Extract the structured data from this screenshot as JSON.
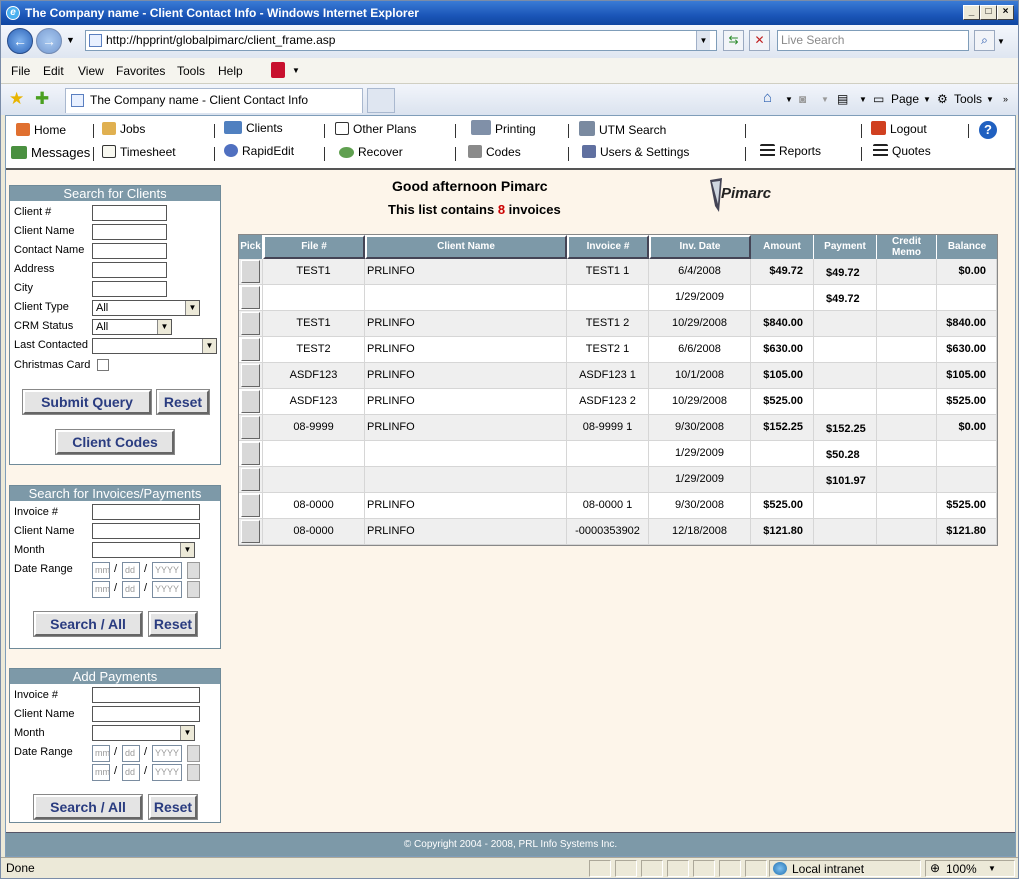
{
  "window": {
    "title": "The Company name - Client Contact Info - Windows Internet Explorer",
    "app_icon": "ie-icon"
  },
  "browser": {
    "url": "http://hpprint/globalpimarc/client_frame.asp",
    "live_search_placeholder": "Live Search",
    "menu": [
      "File",
      "Edit",
      "View",
      "Favorites",
      "Tools",
      "Help"
    ],
    "tab_title": "The Company name - Client Contact Info",
    "toolbar": {
      "page": "Page",
      "tools": "Tools"
    }
  },
  "nav": {
    "row1": [
      "Home",
      "Jobs",
      "Clients",
      "Other Plans",
      "Printing",
      "UTM Search",
      "Logout"
    ],
    "row2": [
      "Messages",
      "Timesheet",
      "RapidEdit",
      "Recover",
      "Codes",
      "Users & Settings",
      "Reports",
      "Quotes"
    ]
  },
  "search_clients": {
    "title": "Search for Clients",
    "labels": [
      "Client #",
      "Client Name",
      "Contact Name",
      "Address",
      "City",
      "Client Type",
      "CRM Status",
      "Last Contacted",
      "Christmas Card"
    ],
    "client_type": "All",
    "crm_status": "All",
    "submit": "Submit Query",
    "reset": "Reset",
    "codes": "Client Codes"
  },
  "search_invoices": {
    "title": "Search for Invoices/Payments",
    "labels": [
      "Invoice #",
      "Client Name",
      "Month",
      "Date Range"
    ],
    "search": "Search / All",
    "reset": "Reset"
  },
  "add_payments": {
    "title": "Add Payments",
    "labels": [
      "Invoice #",
      "Client Name",
      "Month",
      "Date Range"
    ],
    "search": "Search / All",
    "reset": "Reset"
  },
  "date_placeholders": {
    "mm": "mm",
    "dd": "dd",
    "yyyy": "YYYY"
  },
  "greeting": "Good afternoon Pimarc",
  "count": {
    "prefix": "This list contains",
    "n": "8",
    "suffix": "invoices"
  },
  "logo_text": "Pimarc",
  "table": {
    "headers": [
      "Pick",
      "File #",
      "Client Name",
      "Invoice #",
      "Inv. Date",
      "Amount",
      "Payment",
      "Credit Memo",
      "Balance"
    ],
    "rows": [
      [
        "TEST1",
        "PRLINFO",
        "TEST1 1",
        "6/4/2008",
        "$49.72",
        "$49.72",
        "",
        "$0.00"
      ],
      [
        "",
        "",
        "",
        "1/29/2009",
        "",
        "$49.72",
        "",
        ""
      ],
      [
        "TEST1",
        "PRLINFO",
        "TEST1 2",
        "10/29/2008",
        "$840.00",
        "",
        "",
        "$840.00"
      ],
      [
        "TEST2",
        "PRLINFO",
        "TEST2 1",
        "6/6/2008",
        "$630.00",
        "",
        "",
        "$630.00"
      ],
      [
        "ASDF123",
        "PRLINFO",
        "ASDF123 1",
        "10/1/2008",
        "$105.00",
        "",
        "",
        "$105.00"
      ],
      [
        "ASDF123",
        "PRLINFO",
        "ASDF123 2",
        "10/29/2008",
        "$525.00",
        "",
        "",
        "$525.00"
      ],
      [
        "08-9999",
        "PRLINFO",
        "08-9999 1",
        "9/30/2008",
        "$152.25",
        "$152.25",
        "",
        "$0.00"
      ],
      [
        "",
        "",
        "",
        "1/29/2009",
        "",
        "$50.28",
        "",
        ""
      ],
      [
        "",
        "",
        "",
        "1/29/2009",
        "",
        "$101.97",
        "",
        ""
      ],
      [
        "08-0000",
        "PRLINFO",
        "08-0000 1",
        "9/30/2008",
        "$525.00",
        "",
        "",
        "$525.00"
      ],
      [
        "08-0000",
        "PRLINFO",
        "-0000353902",
        "12/18/2008",
        "$121.80",
        "",
        "",
        "$121.80"
      ]
    ]
  },
  "footer": "© Copyright 2004 - 2008, PRL Info Systems Inc.",
  "status": {
    "text": "Done",
    "zone": "Local intranet",
    "zoom": "100%"
  }
}
